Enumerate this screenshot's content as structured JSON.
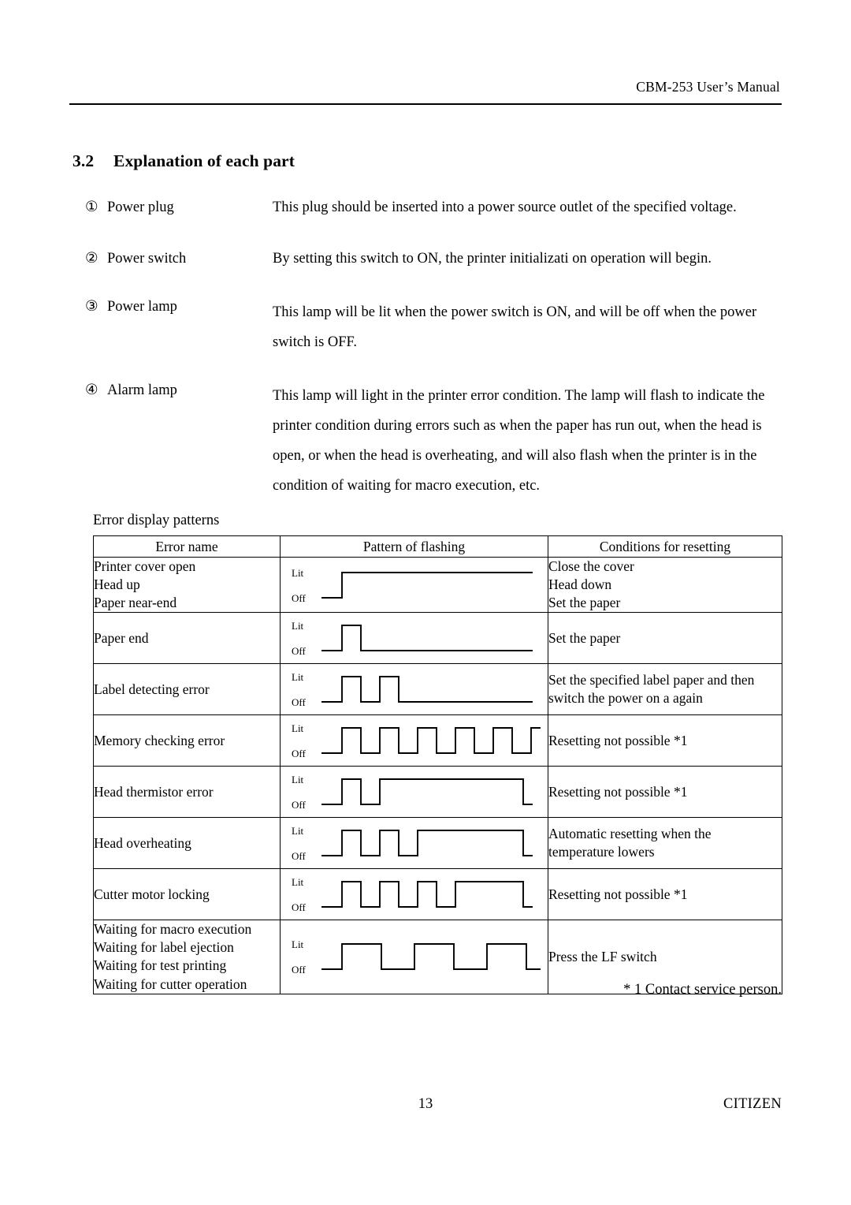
{
  "header": {
    "manual_title": "CBM-253 User’s Manual"
  },
  "section": {
    "number": "3.2",
    "title": "Explanation of each part"
  },
  "parts": [
    {
      "marker": "①",
      "label": "Power plug",
      "description": "This plug should be inserted into a power source outlet of the specified voltage."
    },
    {
      "marker": "②",
      "label": "Power switch",
      "description": "By setting this switch to ON, the printer initializati on operation will begin."
    },
    {
      "marker": "③",
      "label": "Power lamp",
      "description": "This lamp will be lit when the power switch is ON, and will be off when the power switch is OFF."
    },
    {
      "marker": "④",
      "label": "Alarm lamp",
      "description": "This lamp will light in the printer error condition. The lamp will flash to indicate the printer condition during errors such as when the paper has run out, when the head is open, or when the head is overheating, and will also flash when the printer is in the condition of waiting for macro execution, etc."
    }
  ],
  "patterns_caption": "Error display patterns",
  "table": {
    "columns": [
      "Error name",
      "Pattern of flashing",
      "Conditions for resetting"
    ],
    "wave_axis_labels": {
      "high": "Lit",
      "low": "Off"
    },
    "rows": [
      {
        "names": [
          "Printer cover open",
          "Head up",
          "Paper near-end"
        ],
        "conditions": [
          "Close the cover",
          "Head down",
          "Set the paper"
        ],
        "wave": {
          "name": "steady-on",
          "segments": [
            [
              0,
              "off",
              26
            ],
            [
              26,
              "on",
              242
            ]
          ]
        }
      },
      {
        "names": [
          "Paper end"
        ],
        "conditions": [
          "Set the paper"
        ],
        "wave": {
          "name": "single-short-pulse",
          "segments": [
            [
              0,
              "off",
              26
            ],
            [
              26,
              "on",
              24
            ],
            [
              50,
              "off",
              218
            ]
          ]
        }
      },
      {
        "names": [
          "Label detecting error"
        ],
        "conditions": [
          "Set the specified label paper and then",
          "switch the power on a again"
        ],
        "wave": {
          "name": "two-short-pulses",
          "segments": [
            [
              0,
              "off",
              26
            ],
            [
              26,
              "on",
              24
            ],
            [
              50,
              "off",
              24
            ],
            [
              74,
              "on",
              24
            ],
            [
              98,
              "off",
              170
            ]
          ]
        }
      },
      {
        "names": [
          "Memory checking error"
        ],
        "conditions": [
          "Resetting not possible *1"
        ],
        "wave": {
          "name": "continuous-pulses-6",
          "segments": [
            [
              0,
              "off",
              26
            ],
            [
              26,
              "on",
              24
            ],
            [
              50,
              "off",
              24
            ],
            [
              74,
              "on",
              24
            ],
            [
              98,
              "off",
              24
            ],
            [
              122,
              "on",
              24
            ],
            [
              146,
              "off",
              24
            ],
            [
              170,
              "on",
              24
            ],
            [
              194,
              "off",
              24
            ],
            [
              218,
              "on",
              24
            ],
            [
              242,
              "off",
              24
            ],
            [
              266,
              "on",
              24
            ],
            [
              290,
              "off",
              12
            ]
          ]
        }
      },
      {
        "names": [
          "Head thermistor error"
        ],
        "conditions": [
          "Resetting not possible *1"
        ],
        "wave": {
          "name": "one-short-then-long",
          "segments": [
            [
              0,
              "off",
              26
            ],
            [
              26,
              "on",
              24
            ],
            [
              50,
              "off",
              24
            ],
            [
              74,
              "on",
              182
            ],
            [
              256,
              "off",
              12
            ]
          ]
        }
      },
      {
        "names": [
          "Head overheating"
        ],
        "conditions": [
          "Automatic resetting when the",
          "temperature lowers"
        ],
        "wave": {
          "name": "two-short-then-long",
          "segments": [
            [
              0,
              "off",
              26
            ],
            [
              26,
              "on",
              24
            ],
            [
              50,
              "off",
              24
            ],
            [
              74,
              "on",
              24
            ],
            [
              98,
              "off",
              24
            ],
            [
              122,
              "on",
              134
            ],
            [
              256,
              "off",
              12
            ]
          ]
        }
      },
      {
        "names": [
          "Cutter motor locking"
        ],
        "conditions": [
          "Resetting not possible *1"
        ],
        "wave": {
          "name": "three-short-then-long",
          "segments": [
            [
              0,
              "off",
              26
            ],
            [
              26,
              "on",
              24
            ],
            [
              50,
              "off",
              24
            ],
            [
              74,
              "on",
              24
            ],
            [
              98,
              "off",
              24
            ],
            [
              122,
              "on",
              24
            ],
            [
              146,
              "off",
              24
            ],
            [
              170,
              "on",
              86
            ],
            [
              256,
              "off",
              12
            ]
          ]
        }
      },
      {
        "names": [
          "Waiting for macro execution",
          "Waiting for label ejection",
          "Waiting for test printing",
          "Waiting for cutter operation"
        ],
        "conditions": [
          "Press the LF switch"
        ],
        "wave": {
          "name": "three-wide-pulses",
          "segments": [
            [
              0,
              "off",
              26
            ],
            [
              26,
              "on",
              50
            ],
            [
              76,
              "off",
              42
            ],
            [
              118,
              "on",
              50
            ],
            [
              168,
              "off",
              42
            ],
            [
              210,
              "on",
              50
            ],
            [
              260,
              "off",
              38
            ]
          ]
        }
      }
    ]
  },
  "footnote": "* 1 Contact service person.",
  "footer": {
    "page_number": "13",
    "brand": "CITIZEN"
  }
}
